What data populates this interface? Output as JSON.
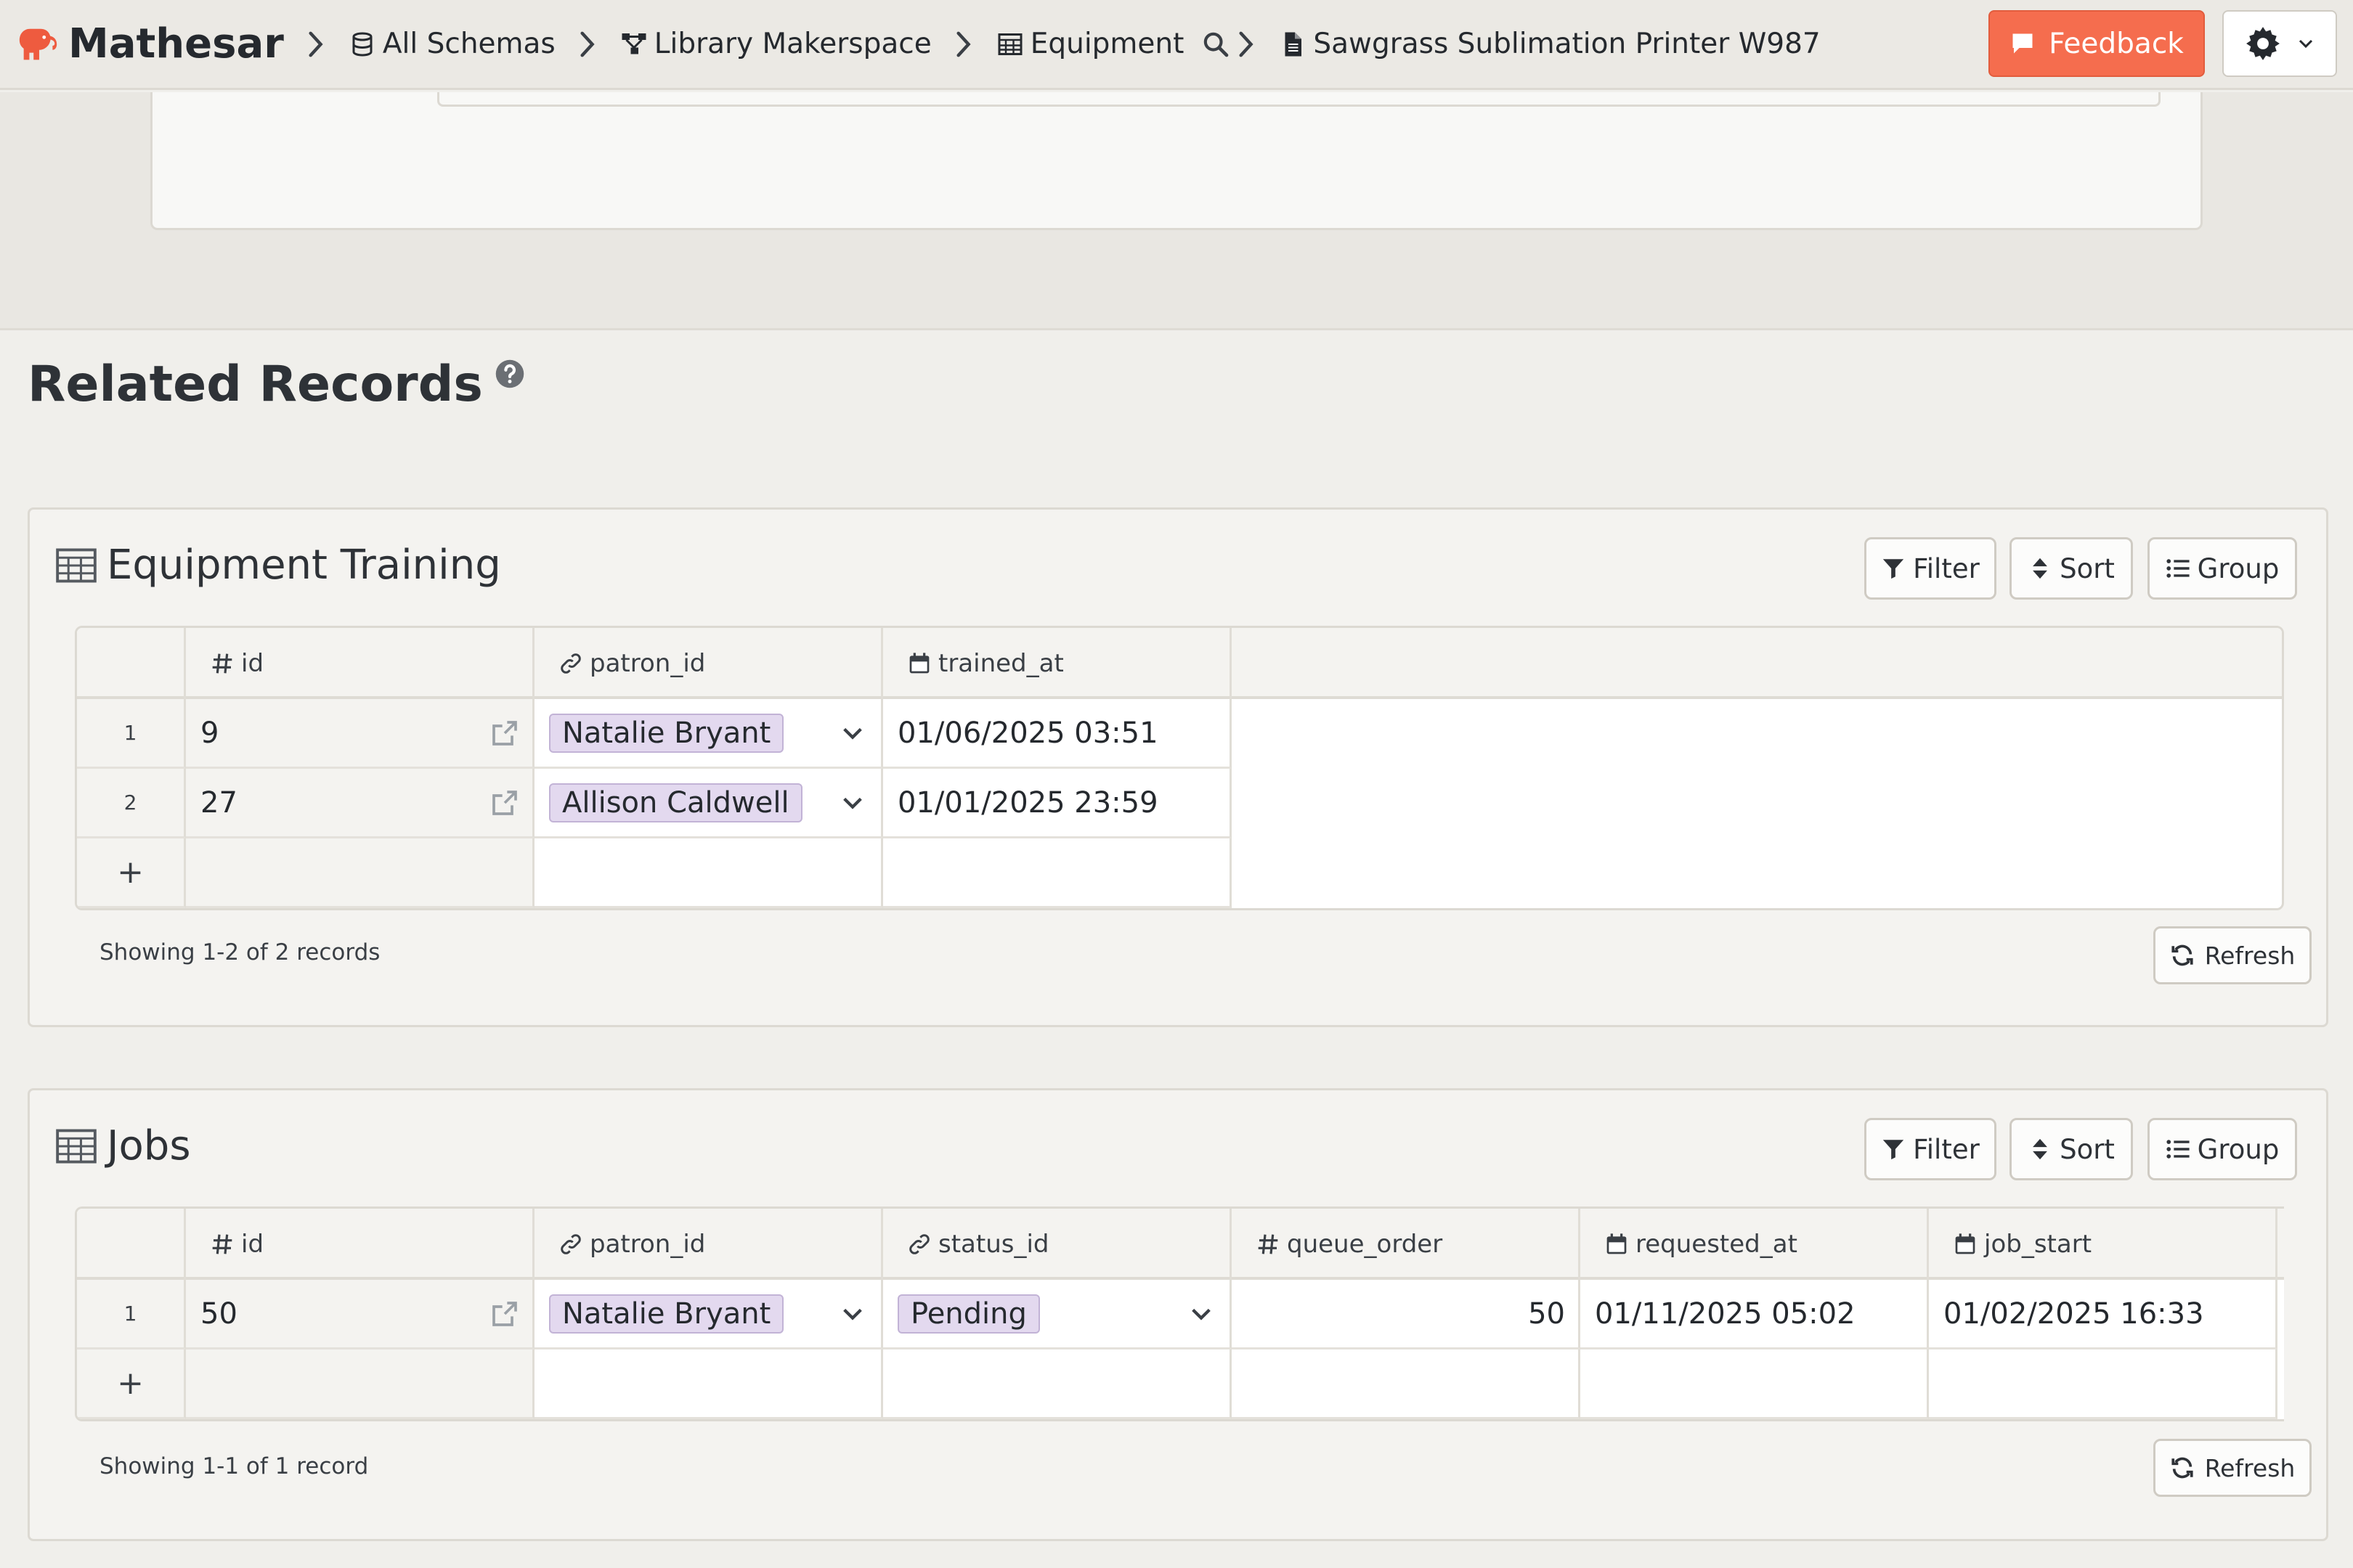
{
  "app": {
    "name": "Mathesar"
  },
  "breadcrumbs": {
    "schemas": "All Schemas",
    "schema": "Library Makerspace",
    "table": "Equipment",
    "record": "Sawgrass Sublimation Printer W987"
  },
  "header": {
    "feedback_label": "Feedback"
  },
  "related": {
    "title": "Related Records",
    "sections": [
      {
        "title": "Equipment Training",
        "toolbar": {
          "filter": "Filter",
          "sort": "Sort",
          "group": "Group"
        },
        "columns": [
          "id",
          "patron_id",
          "trained_at"
        ],
        "rows": [
          {
            "num": "1",
            "id": "9",
            "patron_id": "Natalie Bryant",
            "trained_at": "01/06/2025 03:51"
          },
          {
            "num": "2",
            "id": "27",
            "patron_id": "Allison Caldwell",
            "trained_at": "01/01/2025 23:59"
          }
        ],
        "add_row": "+",
        "showing": "Showing 1-2 of 2 records",
        "refresh": "Refresh"
      },
      {
        "title": "Jobs",
        "toolbar": {
          "filter": "Filter",
          "sort": "Sort",
          "group": "Group"
        },
        "columns": [
          "id",
          "patron_id",
          "status_id",
          "queue_order",
          "requested_at",
          "job_start"
        ],
        "rows": [
          {
            "num": "1",
            "id": "50",
            "patron_id": "Natalie Bryant",
            "status_id": "Pending",
            "queue_order": "50",
            "requested_at": "01/11/2025 05:02",
            "job_start": "01/02/2025 16:33"
          }
        ],
        "add_row": "+",
        "showing": "Showing 1-1 of 1 record",
        "refresh": "Refresh"
      }
    ]
  },
  "colors": {
    "accent": "#f56d4e",
    "pill_bg": "#e3d9ef",
    "pill_border": "#c2b3d6"
  }
}
